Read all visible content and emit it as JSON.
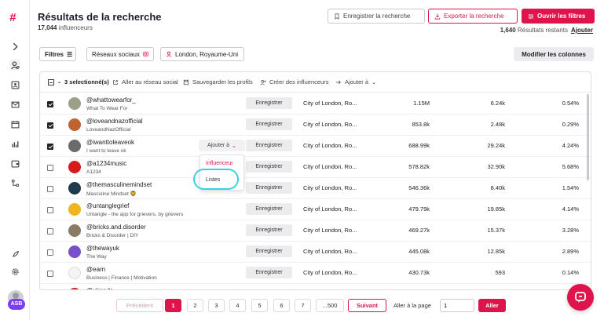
{
  "header": {
    "title": "Résultats de la recherche",
    "count_value": "17,044",
    "count_label": "influenceurs",
    "save_search": "Enregistrer la recherche",
    "export_search": "Exporter la recherche",
    "open_filters": "Ouvrir les filtres",
    "remaining_value": "1,640",
    "remaining_label": "Résultats restants",
    "add_link": "Ajouter"
  },
  "filters": {
    "filtres": "Filtres",
    "social": "Réseaux sociaux",
    "location": "London, Royaume-Uni",
    "modify_columns": "Modifier les colonnes"
  },
  "toolbar": {
    "selected": "3 selectionné(s)",
    "goto_social": "Aller au réseau social",
    "save_profiles": "Sauvegarder les profils",
    "create_influencers": "Créer des influenceurs",
    "add_to": "Ajouter à"
  },
  "row_action": {
    "save": "Enregistrer",
    "add_to": "Ajouter à"
  },
  "rows": [
    {
      "checked": true,
      "handle": "@whattowearfor_",
      "desc": "What To Wear For",
      "location": "City of London, Ro...",
      "followers": "1.15M",
      "engagement": "6.24k",
      "rate": "0.54%",
      "avatar_color": "#9aa08a"
    },
    {
      "checked": true,
      "handle": "@loveandnazofficial",
      "desc": "LoveandNazOfficial",
      "location": "City of London, Ro...",
      "followers": "853.8k",
      "engagement": "2.48k",
      "rate": "0.29%",
      "avatar_color": "#c0622e"
    },
    {
      "checked": true,
      "handle": "@iwanttoleaveok",
      "desc": "I want to leave ok",
      "location": "City of London, Ro...",
      "followers": "688.99k",
      "engagement": "29.24k",
      "rate": "4.24%",
      "avatar_color": "#6b6b6b"
    },
    {
      "checked": false,
      "handle": "@a1234music",
      "desc": "A1234",
      "location": "City of London, Ro...",
      "followers": "578.82k",
      "engagement": "32.90k",
      "rate": "5.68%",
      "avatar_color": "#d81c1c"
    },
    {
      "checked": false,
      "handle": "@themasculinemindset",
      "desc": "Masculine Mindset 🦁",
      "location": "City of London, Ro...",
      "followers": "546.36k",
      "engagement": "8.40k",
      "rate": "1.54%",
      "avatar_color": "#1f3b4d"
    },
    {
      "checked": false,
      "handle": "@untanglegrief",
      "desc": "Untangle - the app for grievers, by grievers",
      "location": "City of London, Ro...",
      "followers": "479.79k",
      "engagement": "19.85k",
      "rate": "4.14%",
      "avatar_color": "#f0b41c"
    },
    {
      "checked": false,
      "handle": "@bricks.and.disorder",
      "desc": "Bricks & Disorder | DIY",
      "location": "City of London, Ro...",
      "followers": "469.27k",
      "engagement": "15.37k",
      "rate": "3.28%",
      "avatar_color": "#8a7a66"
    },
    {
      "checked": false,
      "handle": "@thewayuk",
      "desc": "The Way",
      "location": "City of London, Ro...",
      "followers": "445.08k",
      "engagement": "12.85k",
      "rate": "2.89%",
      "avatar_color": "#7b4fc9"
    },
    {
      "checked": false,
      "handle": "@earn",
      "desc": "Business | Finance | Motivation",
      "location": "City of London, Ro...",
      "followers": "430.73k",
      "engagement": "593",
      "rate": "0.14%",
      "avatar_color": "#f4f4f4"
    },
    {
      "checked": false,
      "handle": "@ukgods",
      "desc": "",
      "location": "",
      "followers": "",
      "engagement": "",
      "rate": "",
      "avatar_color": "#c22"
    }
  ],
  "dropdown": {
    "influencer": "Influenceur",
    "lists": "Listes"
  },
  "pagination": {
    "prev": "Précédent",
    "pages": [
      "1",
      "2",
      "3",
      "4",
      "5",
      "6",
      "7",
      "...500"
    ],
    "next": "Suivant",
    "goto_label": "Aller à la page",
    "goto_value": "1",
    "goto_button": "Aller"
  },
  "user": {
    "initials": "ASB"
  },
  "colors": {
    "accent": "#e0144c",
    "highlight": "#35d3e3"
  }
}
